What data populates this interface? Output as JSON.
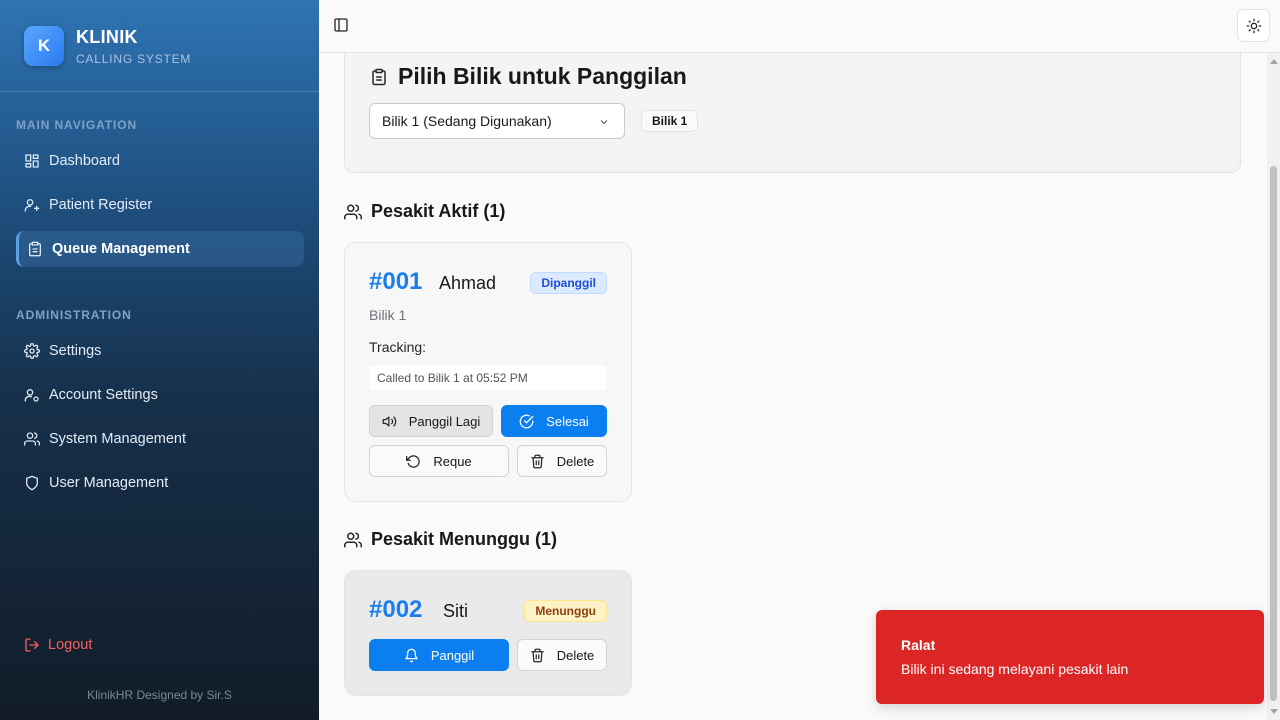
{
  "brand": {
    "logo_letter": "K",
    "title": "KLINIK",
    "subtitle": "CALLING SYSTEM"
  },
  "sidebar": {
    "main_label": "MAIN NAVIGATION",
    "main_items": [
      {
        "label": "Dashboard",
        "icon": "dashboard-icon"
      },
      {
        "label": "Patient Register",
        "icon": "user-plus-icon"
      },
      {
        "label": "Queue Management",
        "icon": "clipboard-icon",
        "active": true
      }
    ],
    "admin_label": "ADMINISTRATION",
    "admin_items": [
      {
        "label": "Settings",
        "icon": "gear-icon"
      },
      {
        "label": "Account Settings",
        "icon": "user-cog-icon"
      },
      {
        "label": "System Management",
        "icon": "users-icon"
      },
      {
        "label": "User Management",
        "icon": "shield-icon"
      }
    ],
    "logout_label": "Logout",
    "credit": "KlinikHR Designed by Sir.S"
  },
  "selector": {
    "title": "Pilih Bilik untuk Panggilan",
    "selected": "Bilik 1 (Sedang Digunakan)",
    "badge": "Bilik 1"
  },
  "active_section": {
    "heading": "Pesakit Aktif (1)",
    "patient": {
      "number": "#001",
      "name": "Ahmad",
      "status": "Dipanggil",
      "bilik": "Bilik 1",
      "tracking_label": "Tracking:",
      "tracking": "Called to Bilik 1 at 05:52 PM",
      "btn_recall": "Panggil Lagi",
      "btn_done": "Selesai",
      "btn_requeue": "Reque",
      "btn_delete": "Delete"
    }
  },
  "waiting_section": {
    "heading": "Pesakit Menunggu (1)",
    "patient": {
      "number": "#002",
      "name": "Siti",
      "status": "Menunggu",
      "btn_call": "Panggil",
      "btn_delete": "Delete"
    }
  },
  "toast": {
    "title": "Ralat",
    "message": "Bilik ini sedang melayani pesakit lain",
    "color": "#dc2626"
  },
  "colors": {
    "accent": "#0b7ff0",
    "called": "#1d4ed8",
    "waiting": "#92400e"
  }
}
